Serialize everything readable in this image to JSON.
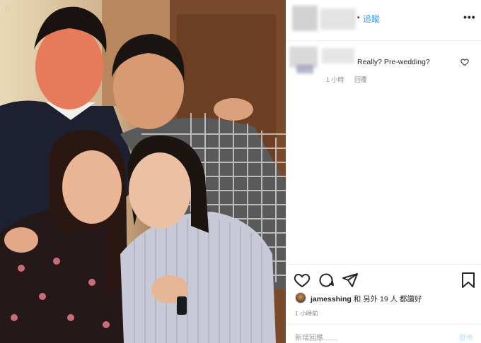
{
  "photo": {
    "description_icon": "download-arrow-icon"
  },
  "header": {
    "follow_label": "追蹤",
    "more_icon": "more-options-icon"
  },
  "comment": {
    "text": "Really? Pre-wedding?",
    "time": "1 小時",
    "reply": "回覆"
  },
  "actions": {
    "icons": [
      "heart-icon",
      "comment-icon",
      "share-icon",
      "bookmark-icon"
    ],
    "liker_name": "jamesshing",
    "likes_text": "和 另外 19 人 都讚好",
    "time_ago": "1 小時前"
  },
  "add_comment": {
    "placeholder": "新增回應……",
    "post_label": "發佈"
  }
}
